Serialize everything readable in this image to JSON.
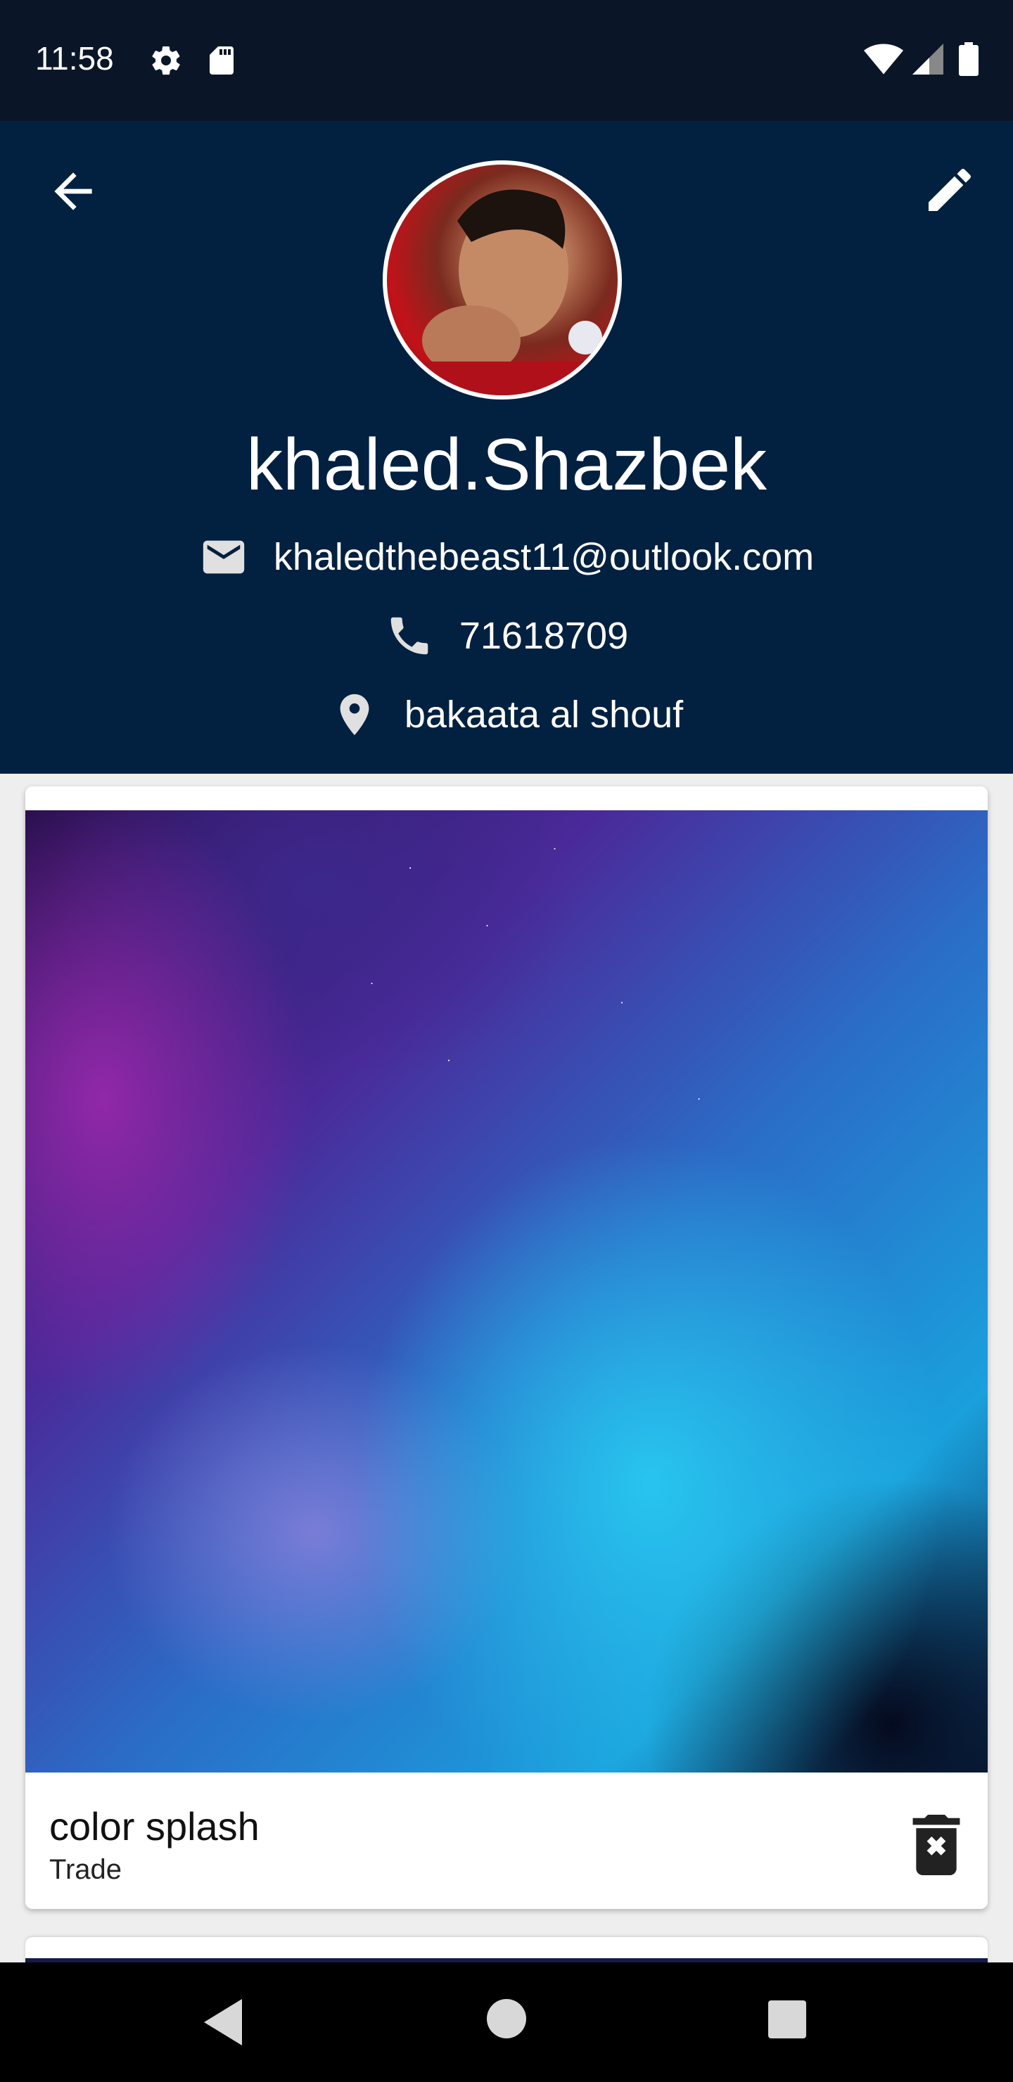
{
  "status_bar": {
    "time": "11:58",
    "icons": [
      "gear-icon",
      "sd-card-icon",
      "wifi-icon",
      "signal-icon",
      "battery-icon"
    ]
  },
  "profile": {
    "username": "khaled.Shazbek",
    "email": "khaledthebeast11@outlook.com",
    "phone": "71618709",
    "location": "bakaata al shouf"
  },
  "items": [
    {
      "title": "color splash",
      "subtitle": "Trade"
    }
  ],
  "colors": {
    "header_bg": "#022040",
    "status_bg": "#0a1628",
    "page_bg": "#eeeeee"
  }
}
